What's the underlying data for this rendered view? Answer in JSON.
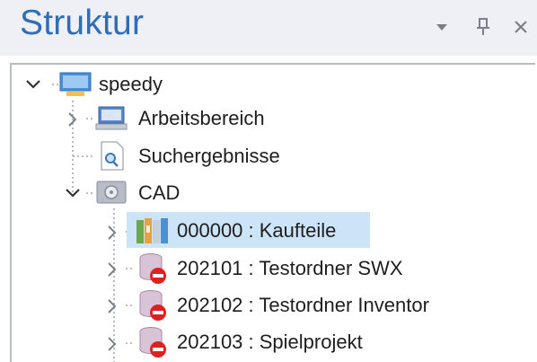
{
  "panel": {
    "title": "Struktur",
    "buttons": [
      {
        "name": "dropdown-icon",
        "glyph": "▾"
      },
      {
        "name": "pin-icon"
      },
      {
        "name": "close-icon",
        "glyph": "✕"
      }
    ]
  },
  "tree": {
    "nodes": [
      {
        "id": "speedy",
        "label": "speedy",
        "icon": "monitor-icon",
        "expanded": true
      },
      {
        "id": "arbeitsbereich",
        "label": "Arbeitsbereich",
        "icon": "workspace-icon",
        "expanded": false
      },
      {
        "id": "suchergebnisse",
        "label": "Suchergebnisse",
        "icon": "search-results-icon"
      },
      {
        "id": "cad",
        "label": "CAD",
        "icon": "drive-icon",
        "expanded": true
      },
      {
        "id": "kaufteile",
        "label": "000000 : Kaufteile",
        "icon": "binders-icon",
        "expanded": false,
        "selected": true
      },
      {
        "id": "swx",
        "label": "202101 : Testordner SWX",
        "icon": "database-blocked-icon",
        "expanded": false
      },
      {
        "id": "inventor",
        "label": "202102 : Testordner Inventor",
        "icon": "database-blocked-icon",
        "expanded": false
      },
      {
        "id": "spielprojekt",
        "label": "202103 : Spielprojekt",
        "icon": "database-blocked-icon",
        "expanded": false
      }
    ]
  },
  "colors": {
    "title": "#2f6db5",
    "selection": "#cce4f7",
    "blocked": "#e02020"
  }
}
